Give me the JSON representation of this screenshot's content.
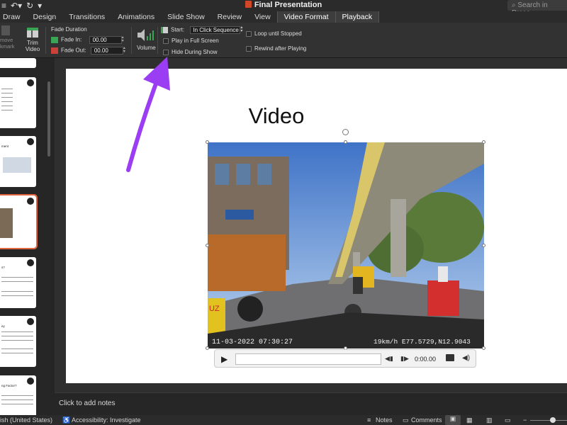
{
  "window": {
    "title": "Final Presentation"
  },
  "search": {
    "placeholder": "Search in Prese"
  },
  "tabs": [
    "Draw",
    "Design",
    "Transitions",
    "Animations",
    "Slide Show",
    "Review",
    "View",
    "Video Format",
    "Playback"
  ],
  "active_tab": "Playback",
  "ribbon": {
    "bookmark_label_1": "move",
    "bookmark_label_2": "kmark",
    "trim_label_1": "Trim",
    "trim_label_2": "Video",
    "fade_title": "Fade Duration",
    "fade_in_label": "Fade In:",
    "fade_in_value": "00.00",
    "fade_out_label": "Fade Out:",
    "fade_out_value": "00.00",
    "volume_label": "Volume",
    "start_label": "Start:",
    "start_value": "In Click Sequence",
    "play_full_screen": "Play in Full Screen",
    "hide_during_show": "Hide During Show",
    "loop_until_stopped": "Loop until Stopped",
    "rewind_after_playing": "Rewind after Playing"
  },
  "slide": {
    "title": "Video",
    "video_overlay_left": "11-03-2022 07:30:27",
    "video_overlay_right": "19km/h E77.5729,N12.9043",
    "sign_text": "UZ"
  },
  "player": {
    "time": "0:00.00"
  },
  "thumbnails": [
    {
      "title": ""
    },
    {
      "title": "ment"
    },
    {
      "title": ""
    },
    {
      "title": "s?"
    },
    {
      "title": "ey"
    },
    {
      "title": "ng Factor?"
    }
  ],
  "notes": {
    "placeholder": "Click to add notes"
  },
  "status": {
    "language": "ish (United States)",
    "accessibility": "Accessibility: Investigate",
    "notes": "Notes",
    "comments": "Comments"
  },
  "colors": {
    "accent": "#e0653c",
    "arrow": "#9b3df2"
  }
}
